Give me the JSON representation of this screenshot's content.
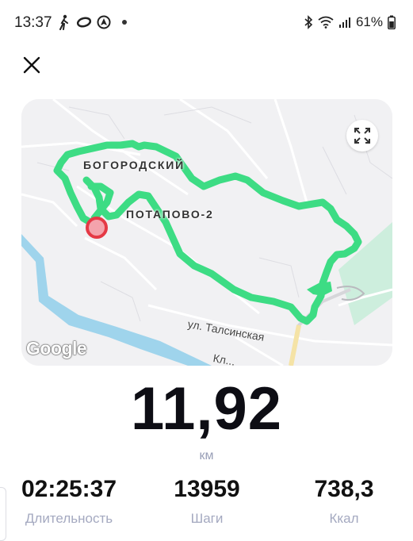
{
  "status_bar": {
    "time": "13:37",
    "battery": "61%",
    "left_icons": [
      "walk-icon",
      "oval-icon",
      "location-icon"
    ],
    "right_icons": [
      "bluetooth-icon",
      "wifi-icon",
      "signal-icon",
      "battery-icon"
    ]
  },
  "map": {
    "labels": {
      "area1": "БОГОРОДСКИЙ",
      "area2": "ПОТАПОВО-2",
      "street1": "ул. Талсинская",
      "street2": "Кл..."
    },
    "google_logo": "Google",
    "route_color": "#3ddc84",
    "start_marker_color": "#e53945"
  },
  "distance": {
    "value": "11,92",
    "unit": "км"
  },
  "stats": [
    {
      "value": "02:25:37",
      "label": "Длительность"
    },
    {
      "value": "13959",
      "label": "Шаги"
    },
    {
      "value": "738,3",
      "label": "Ккал"
    }
  ]
}
